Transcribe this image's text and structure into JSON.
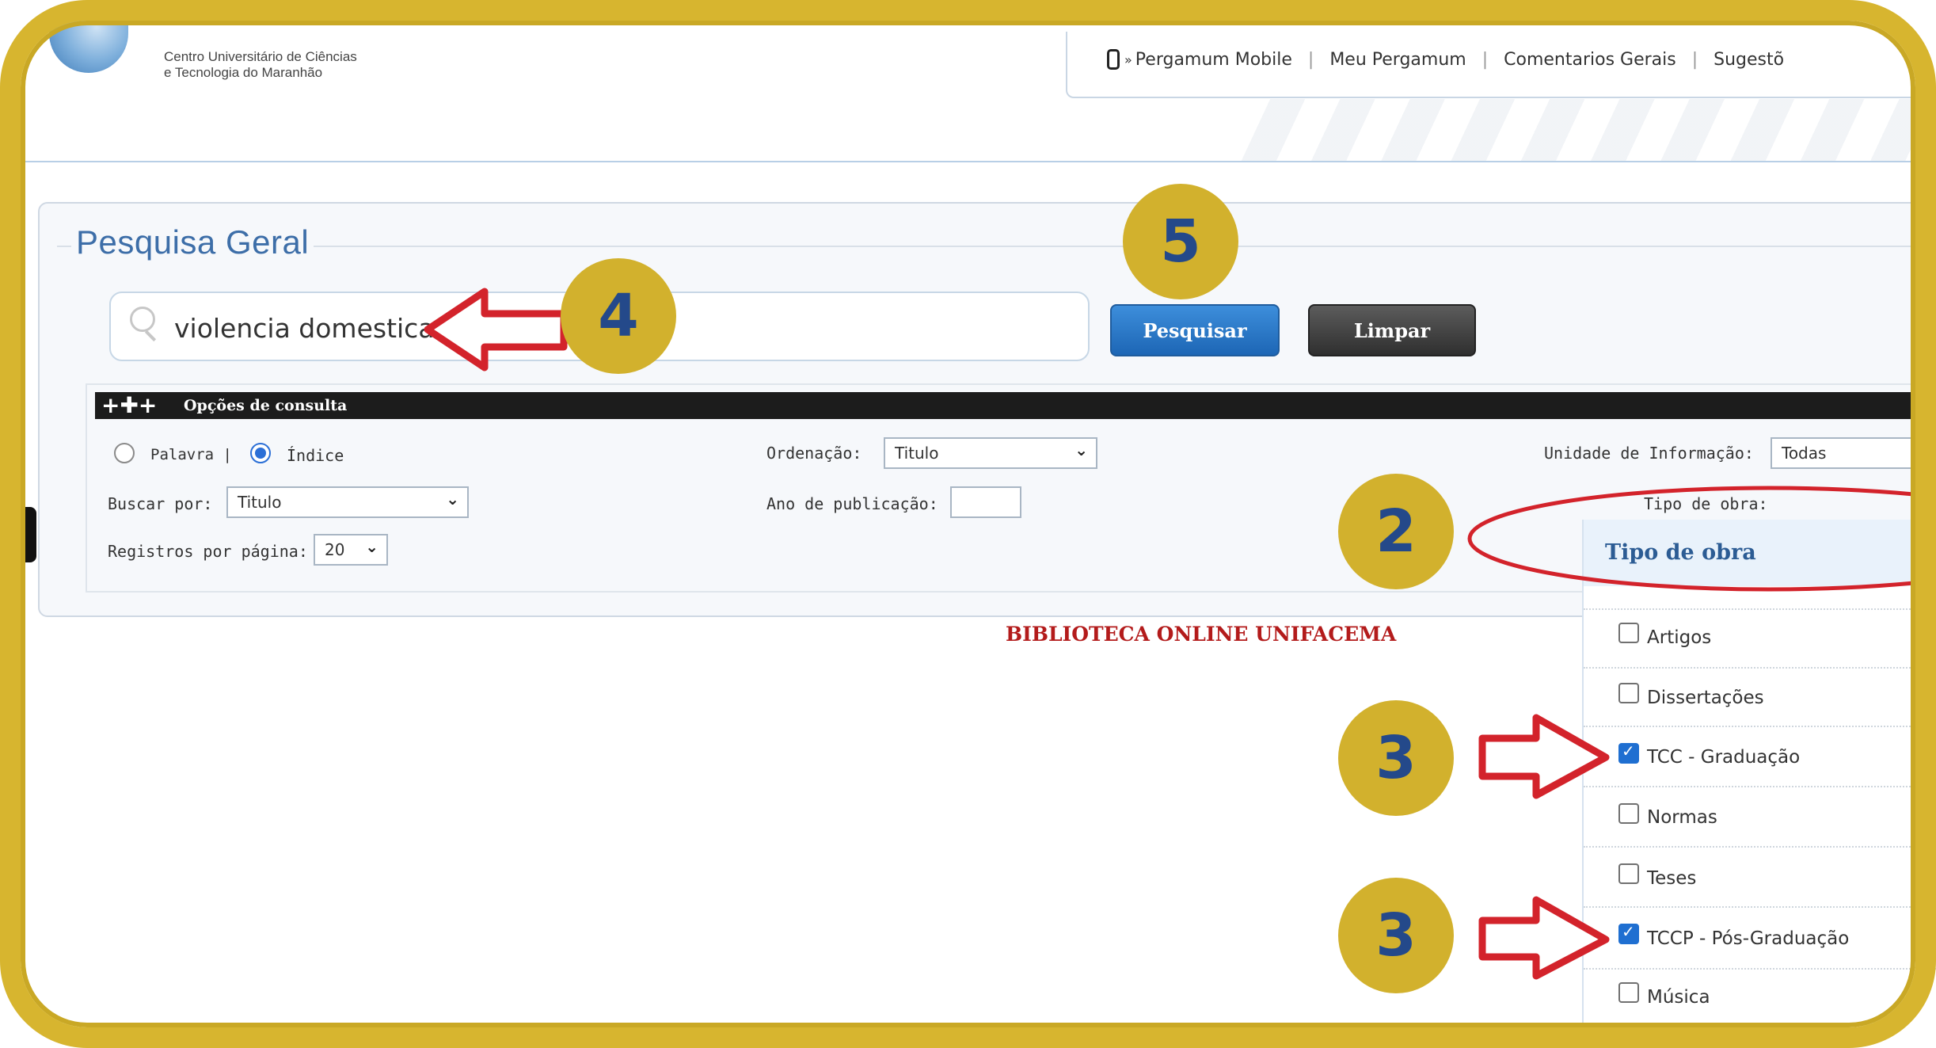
{
  "header": {
    "logo_line1": "Centro Universitário de Ciências",
    "logo_line2": "e Tecnologia do Maranhão",
    "nav": {
      "mobile_prefix": "»",
      "mobile": "Pergamum Mobile",
      "separator": "|",
      "meu": "Meu Pergamum",
      "comentarios": "Comentarios Gerais",
      "sugestoes": "Sugestõ"
    }
  },
  "search": {
    "title": "Pesquisa Geral",
    "query": "violencia domestica",
    "submit_label": "Pesquisar",
    "clear_label": "Limpar"
  },
  "options": {
    "bar_icon": "+✚+",
    "bar_label": "Opções de consulta",
    "radio_palavra": "Palavra |",
    "radio_indice": "Índice",
    "ordenacao_label": "Ordenação:",
    "ordenacao_value": "Titulo",
    "unidade_label": "Unidade de Informação:",
    "unidade_value": "Todas",
    "buscar_label": "Buscar por:",
    "buscar_value": "Titulo",
    "ano_label": "Ano de publicação:",
    "ano_value": "",
    "tipo_label": "Tipo de obra:",
    "registros_label": "Registros por página:",
    "registros_value": "20"
  },
  "footer_title": "BIBLIOTECA ONLINE UNIFACEMA",
  "tipo_dropdown": {
    "title": "Tipo de obra",
    "items": [
      {
        "label": "Artigos",
        "checked": false
      },
      {
        "label": "Dissertações",
        "checked": false
      },
      {
        "label": "TCC - Graduação",
        "checked": true
      },
      {
        "label": "Normas",
        "checked": false
      },
      {
        "label": "Teses",
        "checked": false
      },
      {
        "label": "TCCP - Pós-Graduação",
        "checked": true
      },
      {
        "label": "Música",
        "checked": false
      }
    ]
  },
  "annotations": {
    "badge_search": "4",
    "badge_submit": "5",
    "badge_tipo": "2",
    "badge_tcc": "3",
    "badge_tccp": "3"
  },
  "colors": {
    "frame": "#d7b52f",
    "badge_bg": "#d2b12d",
    "badge_text": "#24498a",
    "arrow": "#d3232b",
    "primary_button": "#1d66b5",
    "secondary_button": "#2f2f2f",
    "title_blue": "#3d6ea8",
    "footer_red": "#b31b1b"
  },
  "icons": {
    "search": "search-icon",
    "mobile": "mobile-phone-icon",
    "dropdown": "chevron-down-icon",
    "checkbox": "checkbox-icon"
  }
}
